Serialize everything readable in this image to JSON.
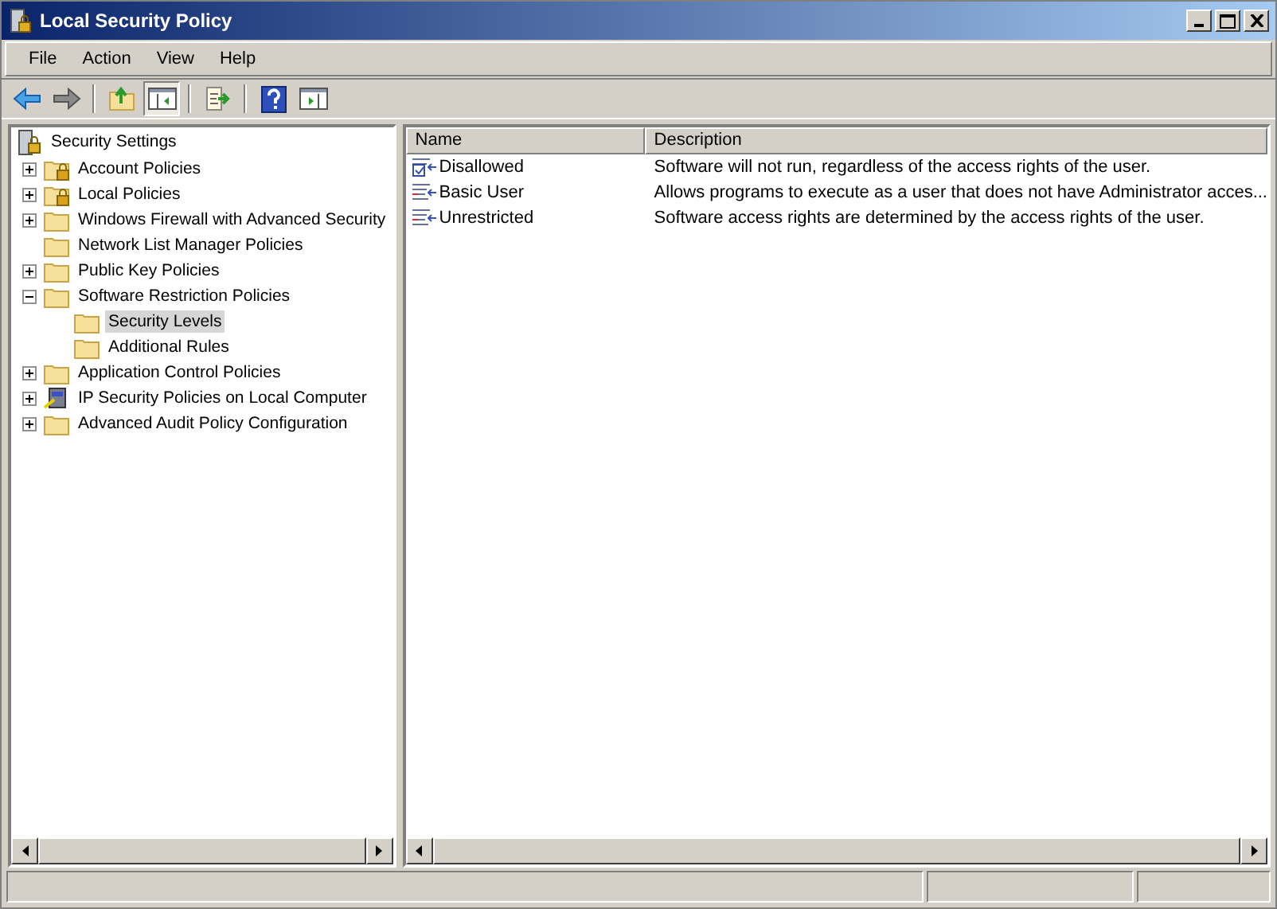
{
  "window": {
    "title": "Local Security Policy"
  },
  "menu": [
    "File",
    "Action",
    "View",
    "Help"
  ],
  "tree": {
    "root": {
      "label": "Security Settings",
      "selected": false
    },
    "items": [
      {
        "label": "Account Policies",
        "kind": "locked-folder",
        "expanded": false,
        "selected": false
      },
      {
        "label": "Local Policies",
        "kind": "locked-folder",
        "expanded": false,
        "selected": false
      },
      {
        "label": "Windows Firewall with Advanced Security",
        "kind": "folder",
        "expanded": false,
        "selected": false
      },
      {
        "label": "Network List Manager Policies",
        "kind": "folder",
        "selected": false
      },
      {
        "label": "Public Key Policies",
        "kind": "folder",
        "expanded": false,
        "selected": false
      },
      {
        "label": "Software Restriction Policies",
        "kind": "folder",
        "expanded": true,
        "selected": false,
        "children": [
          {
            "label": "Security Levels",
            "kind": "folder",
            "selected": true
          },
          {
            "label": "Additional Rules",
            "kind": "folder",
            "selected": false
          }
        ]
      },
      {
        "label": "Application Control Policies",
        "kind": "folder",
        "expanded": false,
        "selected": false
      },
      {
        "label": "IP Security Policies on Local Computer",
        "kind": "computer",
        "expanded": false,
        "selected": false
      },
      {
        "label": "Advanced Audit Policy Configuration",
        "kind": "folder",
        "expanded": false,
        "selected": false
      }
    ]
  },
  "list": {
    "columns": [
      "Name",
      "Description"
    ],
    "rows": [
      {
        "name": "Disallowed",
        "description": "Software will not run, regardless of the access rights of the user.",
        "kind": "default-level"
      },
      {
        "name": "Basic User",
        "description": "Allows programs to execute as a user that does not have Administrator acces...",
        "kind": "level"
      },
      {
        "name": "Unrestricted",
        "description": "Software access rights are determined by the access rights of the user.",
        "kind": "level"
      }
    ]
  }
}
